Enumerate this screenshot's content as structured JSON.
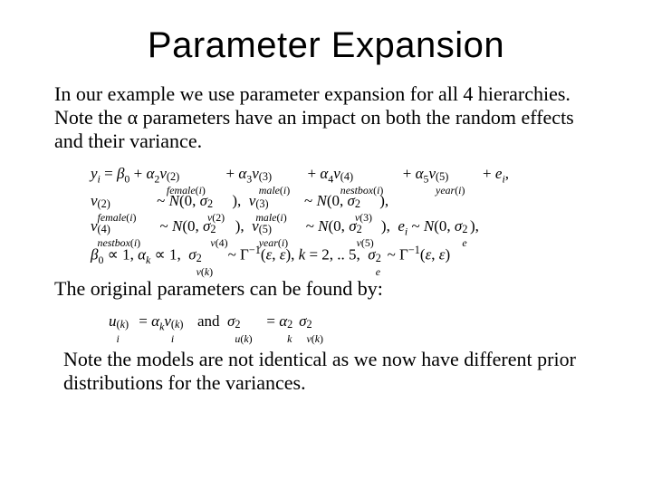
{
  "title": "Parameter Expansion",
  "para1": "In our example we use parameter expansion for all 4 hierarchies. Note the α parameters have an impact on both the random effects and their variance.",
  "para2": "The original parameters can be found by:",
  "para3": "Note the models are not identical as we now have different prior distributions for the variances.",
  "equations": {
    "model_line1": "y_i = β_0 + α_2 ν_{female(i)}^{(2)} + α_3 ν_{male(i)}^{(3)} + α_4 ν_{nestbox(i)}^{(4)} + α_5 ν_{year(i)}^{(5)} + e_i,",
    "model_line2": "ν_{female(i)}^{(2)} ~ N(0, σ_{ν(2)}^2),  ν_{male(i)}^{(3)} ~ N(0, σ_{ν(3)}^2),",
    "model_line3": "ν_{nestbox(i)}^{(4)} ~ N(0, σ_{ν(4)}^2),  ν_{year(i)}^{(5)} ~ N(0, σ_{ν(5)}^2),  e_i ~ N(0, σ_e^2),",
    "model_line4": "β_0 ∝ 1, α_k ∝ 1, σ_{ν(k)}^2 ~ Γ^{-1}(ε, ε), k = 2, .. 5, σ_e^2 ~ Γ^{-1}(ε, ε)",
    "recover": "u_i^{(k)} = α_k ν_i^{(k)}  and  σ_{u(k)}^2 = α_k^2 σ_{ν(k)}^2"
  }
}
